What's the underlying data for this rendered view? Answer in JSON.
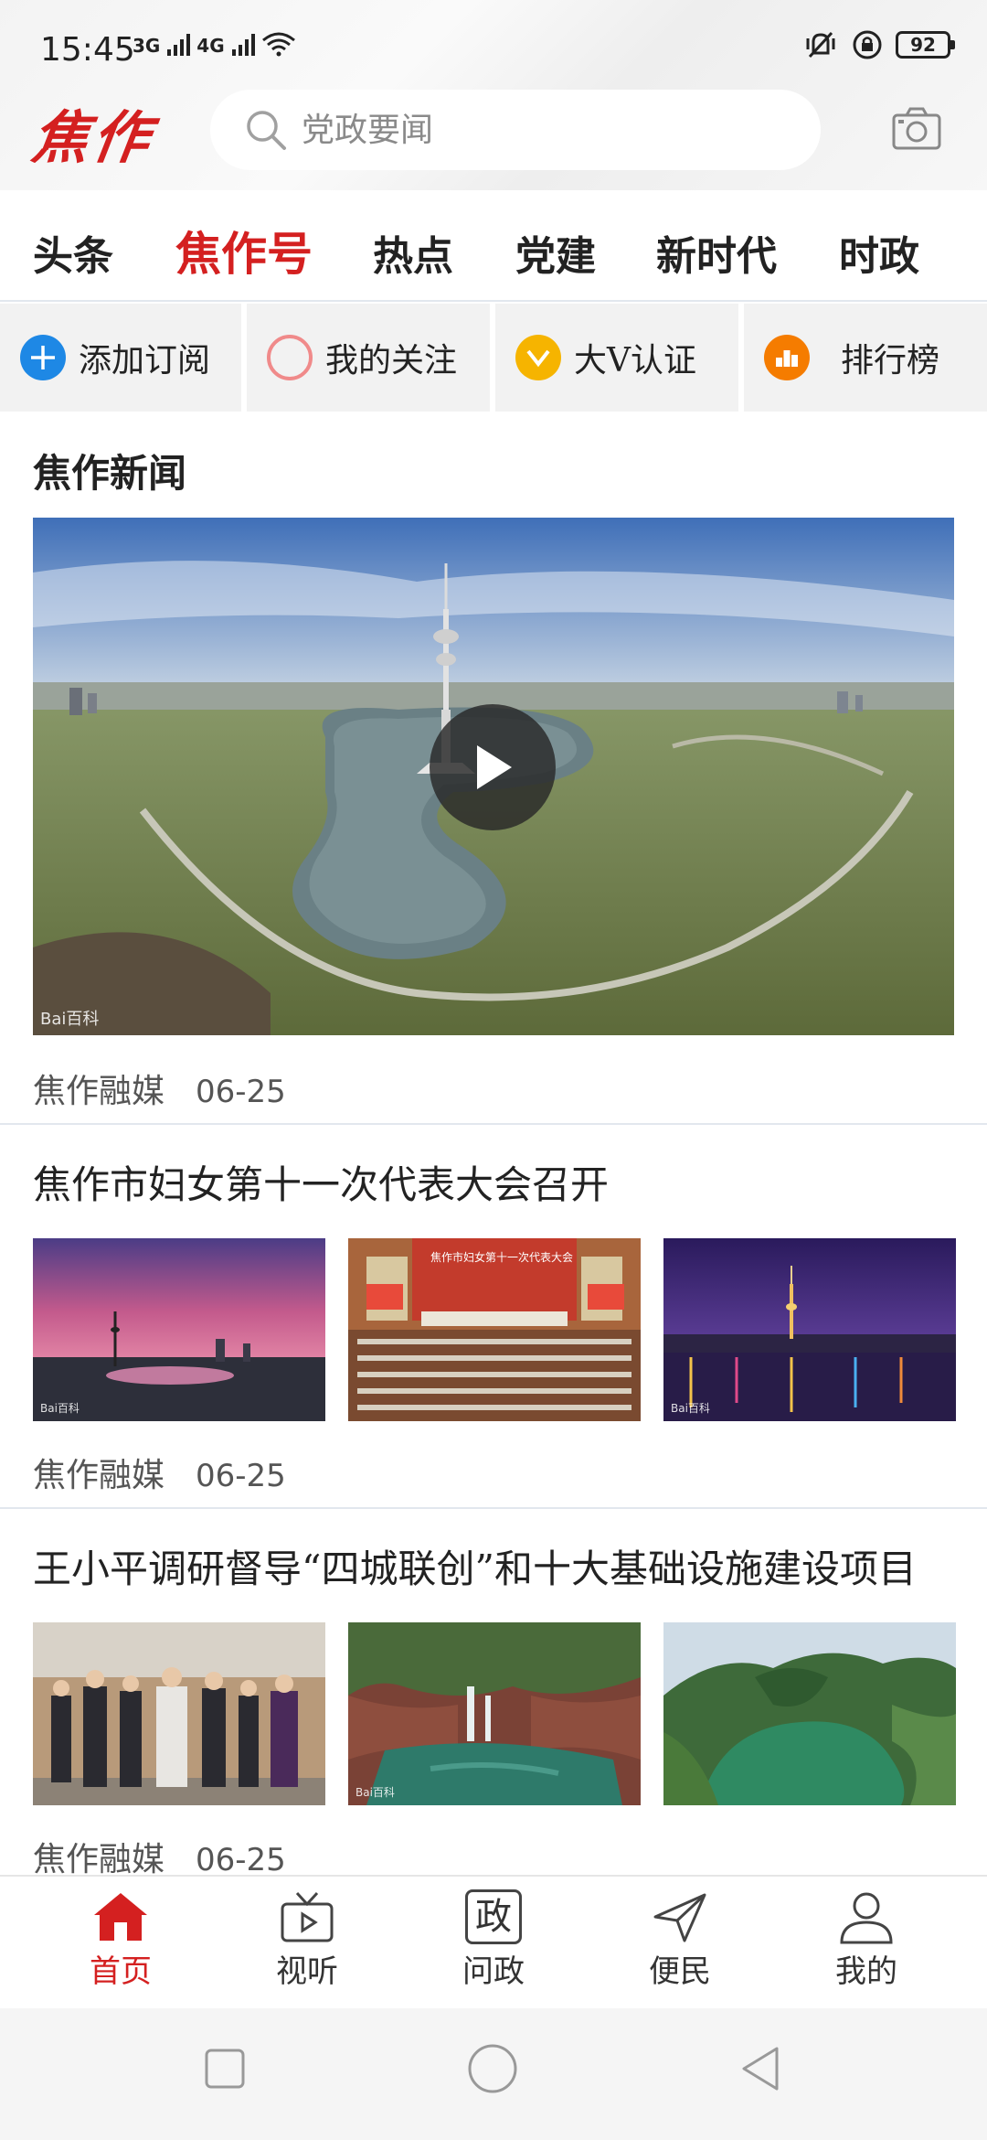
{
  "status_bar": {
    "time": "15:45",
    "network_1": "3G",
    "network_2": "4G",
    "battery": "92"
  },
  "header": {
    "logo": "焦作",
    "search_placeholder": "党政要闻"
  },
  "tabs": [
    {
      "label": "头条",
      "active": false
    },
    {
      "label": "焦作号",
      "active": true
    },
    {
      "label": "热点",
      "active": false
    },
    {
      "label": "党建",
      "active": false
    },
    {
      "label": "新时代",
      "active": false
    },
    {
      "label": "时政",
      "active": false
    }
  ],
  "quick_actions": [
    {
      "label": "添加订阅",
      "icon": "plus-circle-icon",
      "color": "#1e88e5"
    },
    {
      "label": "我的关注",
      "icon": "ring-icon",
      "color": "#f08a8a"
    },
    {
      "label": "大V认证",
      "icon": "check-badge-icon",
      "color": "#f6b400"
    },
    {
      "label": "排行榜",
      "icon": "ranking-icon",
      "color": "#f57c00"
    }
  ],
  "feed": {
    "section_title": "焦作新闻",
    "items": [
      {
        "source": "焦作融媒",
        "date": "06-25",
        "type": "video"
      },
      {
        "title": "焦作市妇女第十一次代表大会召开",
        "source": "焦作融媒",
        "date": "06-25",
        "thumb_caption": "焦作市妇女第十一次代表大会"
      },
      {
        "title": "王小平调研督导“四城联创”和十大基础设施建设项目",
        "source": "焦作融媒",
        "date": "06-25"
      }
    ]
  },
  "bottom_nav": [
    {
      "label": "首页",
      "icon": "home-icon",
      "active": true
    },
    {
      "label": "视听",
      "icon": "tv-icon",
      "active": false
    },
    {
      "label": "问政",
      "icon": "politics-icon",
      "glyph": "政",
      "active": false
    },
    {
      "label": "便民",
      "icon": "send-icon",
      "active": false
    },
    {
      "label": "我的",
      "icon": "user-icon",
      "active": false
    }
  ],
  "colors": {
    "brand": "#d42020",
    "divider": "#e2e7ee"
  }
}
